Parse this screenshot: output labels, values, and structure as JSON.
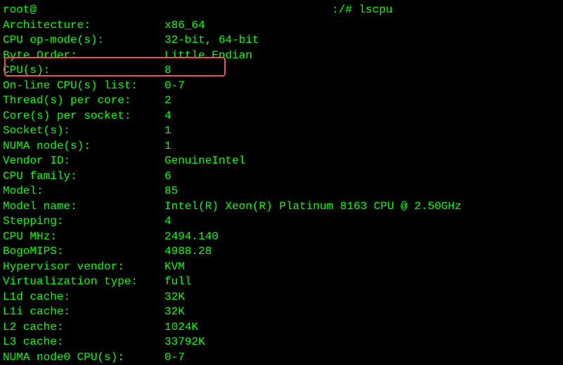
{
  "prompt": {
    "user": "root",
    "host_redacted": true,
    "path_suffix": ":/# ",
    "command": "lscpu"
  },
  "rows": [
    {
      "label": "Architecture:",
      "value": "x86_64"
    },
    {
      "label": "CPU op-mode(s):",
      "value": "32-bit, 64-bit"
    },
    {
      "label": "Byte Order:",
      "value": "Little Endian"
    },
    {
      "label": "CPU(s):",
      "value": "8"
    },
    {
      "label": "On-line CPU(s) list:",
      "value": "0-7"
    },
    {
      "label": "Thread(s) per core:",
      "value": "2"
    },
    {
      "label": "Core(s) per socket:",
      "value": "4"
    },
    {
      "label": "Socket(s):",
      "value": "1"
    },
    {
      "label": "NUMA node(s):",
      "value": "1"
    },
    {
      "label": "Vendor ID:",
      "value": "GenuineIntel"
    },
    {
      "label": "CPU family:",
      "value": "6"
    },
    {
      "label": "Model:",
      "value": "85"
    },
    {
      "label": "Model name:",
      "value": "Intel(R) Xeon(R) Platinum 8163 CPU @ 2.50GHz"
    },
    {
      "label": "Stepping:",
      "value": "4"
    },
    {
      "label": "CPU MHz:",
      "value": "2494.140"
    },
    {
      "label": "BogoMIPS:",
      "value": "4988.28"
    },
    {
      "label": "Hypervisor vendor:",
      "value": "KVM"
    },
    {
      "label": "Virtualization type:",
      "value": "full"
    },
    {
      "label": "L1d cache:",
      "value": "32K"
    },
    {
      "label": "L1i cache:",
      "value": "32K"
    },
    {
      "label": "L2 cache:",
      "value": "1024K"
    },
    {
      "label": "L3 cache:",
      "value": "33792K"
    },
    {
      "label": "NUMA node0 CPU(s):",
      "value": "0-7"
    }
  ],
  "highlight_index": 3
}
